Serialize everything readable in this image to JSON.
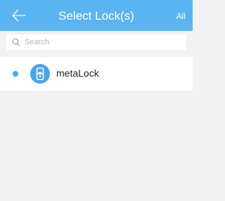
{
  "header": {
    "title": "Select Lock(s)",
    "all_label": "All",
    "back_icon": "arrow-left-icon",
    "color": "#5bb4f2"
  },
  "search": {
    "placeholder": "Search",
    "value": "",
    "icon": "search-icon"
  },
  "locks": [
    {
      "name": "metaLock",
      "selected": true,
      "icon": "door-lock-icon",
      "icon_color": "#4aa3ee"
    }
  ]
}
